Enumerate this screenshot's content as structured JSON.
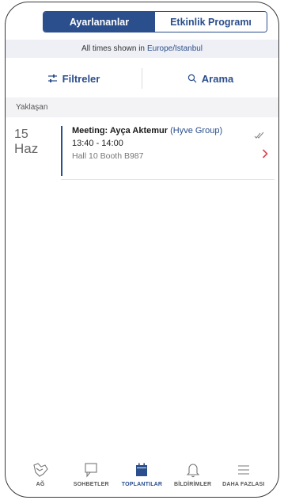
{
  "segments": {
    "active": "Ayarlananlar",
    "inactive": "Etkinlik Programı"
  },
  "timezone": {
    "prefix": "All times shown in",
    "zone": "Europe/Istanbul"
  },
  "actions": {
    "filters": "Filtreler",
    "search": "Arama"
  },
  "section_title": "Yaklaşan",
  "meeting": {
    "day": "15",
    "month": "Haz",
    "title": "Meeting: Ayça Aktemur",
    "company": "(Hyve Group)",
    "time": "13:40 - 14:00",
    "location": "Hall 10 Booth B987"
  },
  "nav": [
    {
      "label": "AĞ",
      "icon": "network-icon"
    },
    {
      "label": "SOHBETLER",
      "icon": "chat-icon"
    },
    {
      "label": "TOPLANTILAR",
      "icon": "calendar-icon"
    },
    {
      "label": "BİLDİRİMLER",
      "icon": "bell-icon"
    },
    {
      "label": "DAHA FAZLASI",
      "icon": "menu-icon"
    }
  ],
  "colors": {
    "brand": "#2b4e8c",
    "accent": "#e0424b"
  }
}
